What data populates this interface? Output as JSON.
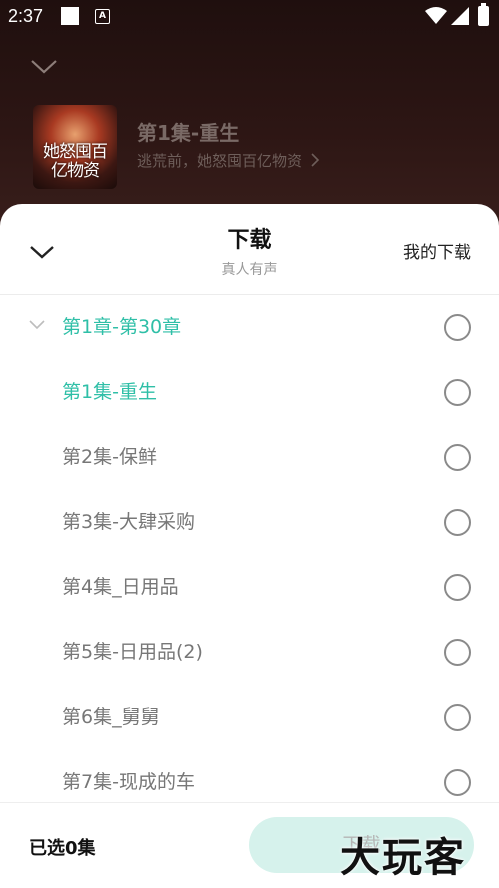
{
  "status_bar": {
    "time": "2:37",
    "badge_letter": "A"
  },
  "now_playing": {
    "title": "第1集-重生",
    "subtitle": "逃荒前，她怒囤百亿物资",
    "cover_text": "她怒囤百亿物资"
  },
  "sheet": {
    "title": "下载",
    "subtitle": "真人有声",
    "my_downloads_label": "我的下载"
  },
  "list": {
    "rows": [
      {
        "label": "第1章-第30章",
        "type": "group",
        "active": true
      },
      {
        "label": "第1集-重生",
        "type": "episode",
        "active": true
      },
      {
        "label": "第2集-保鲜",
        "type": "episode",
        "active": false
      },
      {
        "label": "第3集-大肆采购",
        "type": "episode",
        "active": false
      },
      {
        "label": "第4集_日用品",
        "type": "episode",
        "active": false
      },
      {
        "label": "第5集-日用品(2)",
        "type": "episode",
        "active": false
      },
      {
        "label": "第6集_舅舅",
        "type": "episode",
        "active": false
      },
      {
        "label": "第7集-现成的车",
        "type": "episode",
        "active": false
      }
    ]
  },
  "footer": {
    "selected_label": "已选0集",
    "download_button_label": "下载"
  },
  "watermark": "大玩客",
  "colors": {
    "accent": "#2fbfa7",
    "button_bg": "#d6f2ec"
  },
  "icons": {
    "collapse": "chevron-down-icon",
    "more": "chevron-right-icon",
    "radio": "radio-empty-icon"
  }
}
